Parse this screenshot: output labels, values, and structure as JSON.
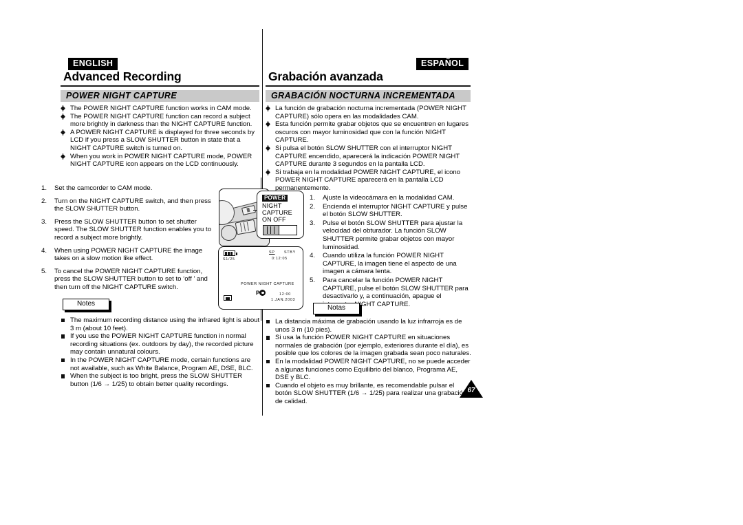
{
  "page": {
    "number": "67"
  },
  "english": {
    "language_badge": "ENGLISH",
    "chapter_title": "Advanced Recording",
    "section_title": "POWER NIGHT CAPTURE",
    "bullets": [
      "The POWER NIGHT CAPTURE function works in CAM mode.",
      "The POWER NIGHT CAPTURE function can record a subject more brightly in darkness than the NIGHT CAPTURE function.",
      "A POWER NIGHT CAPTURE is displayed for three seconds by LCD if you press a SLOW SHUTTER button in state that a NIGHT CAPTURE switch is turned on.",
      "When you work in POWER NIGHT CAPTURE mode, POWER NIGHT CAPTURE icon appears on the LCD continuously."
    ],
    "steps": [
      "Set the camcorder to CAM mode.",
      "Turn on the NIGHT CAPTURE switch, and then press the SLOW SHUTTER button.",
      "Press the SLOW SHUTTER button to set shutter speed. The SLOW SHUTTER function enables you to record a subject more brightly.",
      "When using POWER NIGHT CAPTURE the image takes on a slow motion like effect.",
      "To cancel the POWER NIGHT CAPTURE function, press the SLOW SHUTTER button to set to ‘off ’ and then turn off the NIGHT CAPTURE switch."
    ],
    "notes_label": "Notes",
    "notes": [
      "The maximum recording distance using the infrared light is about 3 m (about 10 feet).",
      "If you use the POWER NIGHT CAPTURE function in normal recording situations (ex. outdoors by day), the recorded picture may contain unnatural colours.",
      "In the POWER NIGHT CAPTURE mode, certain functions are not available, such as White Balance, Program AE, DSE, BLC.",
      "When the subject is too bright, press the SLOW SHUTTER button (1/6 → 1/25) to obtain better quality recordings."
    ]
  },
  "spanish": {
    "language_badge": "ESPAÑOL",
    "chapter_title": "Grabación avanzada",
    "section_title": "GRABACIÓN NOCTURNA INCREMENTADA",
    "bullets": [
      "La función de grabación nocturna incrementada (POWER NIGHT CAPTURE) sólo opera en las modalidades CAM.",
      "Esta función permite grabar objetos que se encuentren en lugares oscuros con mayor luminosidad que con la función NIGHT CAPTURE.",
      "Si pulsa el botón SLOW SHUTTER con el interruptor NIGHT CAPTURE encendido, aparecerá la indicación POWER NIGHT CAPTURE durante 3 segundos en la pantalla LCD.",
      "Si trabaja en la modalidad POWER NIGHT CAPTURE, el icono POWER NIGHT CAPTURE aparecerá en la pantalla LCD permanentemente."
    ],
    "steps": [
      "Ajuste la videocámara en la modalidad CAM.",
      "Encienda el interruptor NIGHT CAPTURE y pulse el botón SLOW SHUTTER.",
      "Pulse el botón SLOW SHUTTER para ajustar la velocidad del obturador. La función SLOW SHUTTER permite grabar objetos con mayor luminosidad.",
      "Cuando utiliza la función POWER NIGHT CAPTURE, la imagen tiene el aspecto de una imagen a cámara lenta.",
      "Para cancelar la función POWER NIGHT CAPTURE, pulse el botón SLOW SHUTTER para desactivarlo y, a continuación, apague el interruptor NIGHT CAPTURE."
    ],
    "notes_label": "Notas",
    "notes": [
      "La distancia máxima de grabación usando la luz infrarroja es de unos 3 m (10 pies).",
      "Si usa la función POWER NIGHT CAPTURE en situaciones normales de grabación (por ejemplo, exteriores durante el día), es posible que los colores de la imagen grabada sean poco naturales.",
      "En la modalidad POWER NIGHT CAPTURE, no se puede acceder a algunas funciones como Equilibrio del blanco, Programa AE, DSE y BLC.",
      "Cuando el objeto es muy brillante, es recomendable pulsar el botón SLOW SHUTTER (1/6 → 1/25) para realizar una grabación de calidad."
    ]
  },
  "illustrations": {
    "switch_callout": {
      "power_label": "POWER",
      "line1": "NIGHT",
      "line2": "CAPTURE",
      "line3": "ON OFF"
    },
    "lcd": {
      "shutter": "S1/25",
      "record_mode": "SP",
      "status": "STBY",
      "timecode": "0:12:05",
      "message": "POWER NIGHT CAPTURE",
      "icon_letter": "P",
      "time": "12:00",
      "date": "1.JAN.2003"
    }
  }
}
